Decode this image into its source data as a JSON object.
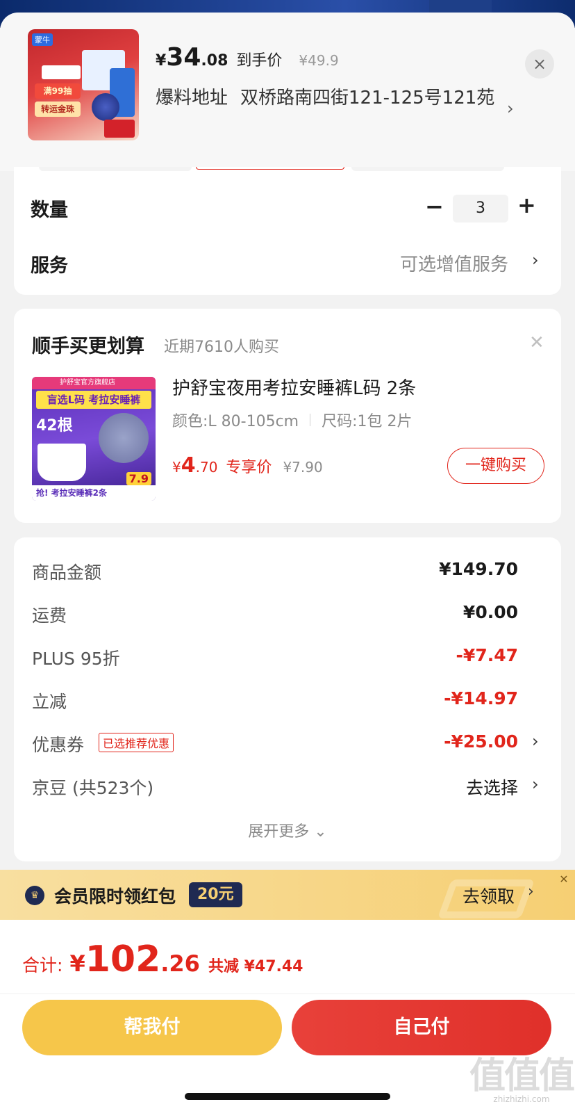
{
  "header": {
    "price_symbol": "¥",
    "price_int": "34",
    "price_dec": ".08",
    "price_tag": "到手价",
    "original_price": "¥49.9",
    "address_label": "爆料地址",
    "address": "双桥路南四街121-125号121苑",
    "close_icon": "close-icon",
    "product_image_text": {
      "brand": "蒙牛",
      "tag1": "满99抽",
      "tag2": "转运金珠"
    }
  },
  "order": {
    "quantity_label": "数量",
    "quantity": "3",
    "minus": "−",
    "plus": "+",
    "service_label": "服务",
    "service_value": "可选增值服务"
  },
  "addon": {
    "title": "顺手买更划算",
    "subtitle": "近期7610人购买",
    "product_name": "护舒宝夜用考拉安睡裤L码 2条",
    "spec_color": "颜色:L 80-105cm",
    "spec_size": "尺码:1包 2片",
    "price_symbol": "¥",
    "price_int": "4",
    "price_dec": ".70",
    "exclusive_label": "专享价",
    "original_price": "¥7.90",
    "buy_button": "一键购买",
    "image_text": {
      "top": "护舒宝官方旗舰店",
      "banner": "盲选L码 考拉安睡裤",
      "count": "42根",
      "bottom": "抢! 考拉安睡裤2条",
      "price": "7.9"
    }
  },
  "summary": {
    "rows": [
      {
        "label": "商品金额",
        "value": "¥149.70"
      },
      {
        "label": "运费",
        "value": "¥0.00"
      },
      {
        "label": "PLUS 95折",
        "value": "-¥7.47"
      },
      {
        "label": "立减",
        "value": "-¥14.97"
      },
      {
        "label": "优惠券",
        "value": "-¥25.00",
        "badge": "已选推荐优惠"
      },
      {
        "label": "京豆 (共523个)",
        "value": "去选择"
      }
    ],
    "expand": "展开更多 ⌄"
  },
  "banner": {
    "text": "会员限时领红包",
    "amount": "20元",
    "action": "去领取"
  },
  "footer": {
    "total_label": "合计:",
    "total_symbol": "¥",
    "total_int": "102",
    "total_dec": ".26",
    "saved": "共减 ¥47.44",
    "help_pay": "帮我付",
    "self_pay": "自己付"
  },
  "watermark": {
    "big": "值值值",
    "small": "zhizhizhi.com"
  },
  "colors": {
    "accent_red": "#e1251b",
    "pay_yellow": "#f6c64a",
    "banner_gold": "#f6cf73",
    "navy": "#1f2a52"
  }
}
